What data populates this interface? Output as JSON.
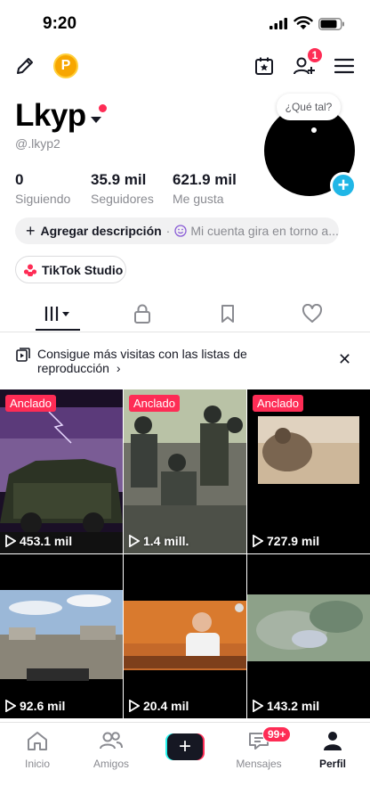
{
  "status_bar": {
    "time": "9:20"
  },
  "notif_badge": "1",
  "coin_label": "P",
  "profile": {
    "name": "Lkyp",
    "handle": "@.lkyp2",
    "bubble": "¿Qué tal?",
    "stats": [
      {
        "value": "0",
        "label": "Siguiendo"
      },
      {
        "value": "35.9 mil",
        "label": "Seguidores"
      },
      {
        "value": "621.9 mil",
        "label": "Me gusta"
      }
    ],
    "add_description": "Agregar descripción",
    "bio_hint": "Mi cuenta gira en torno a...",
    "studio": "TikTok Studio"
  },
  "promo": {
    "text": "Consigue más visitas con las listas de reproducción"
  },
  "videos": [
    {
      "views": "453.1 mil",
      "pinned": "Anclado"
    },
    {
      "views": "1.4 mill.",
      "pinned": "Anclado"
    },
    {
      "views": "727.9 mil",
      "pinned": "Anclado"
    },
    {
      "views": "92.6 mil",
      "pinned": ""
    },
    {
      "views": "20.4 mil",
      "pinned": ""
    },
    {
      "views": "143.2 mil",
      "pinned": ""
    }
  ],
  "nav": {
    "home": "Inicio",
    "friends": "Amigos",
    "messages": "Mensajes",
    "messages_badge": "99+",
    "profile": "Perfil"
  },
  "colors": {
    "accent": "#fe2c55",
    "avatar_plus": "#20b6e6",
    "coin": "#f7a600"
  }
}
